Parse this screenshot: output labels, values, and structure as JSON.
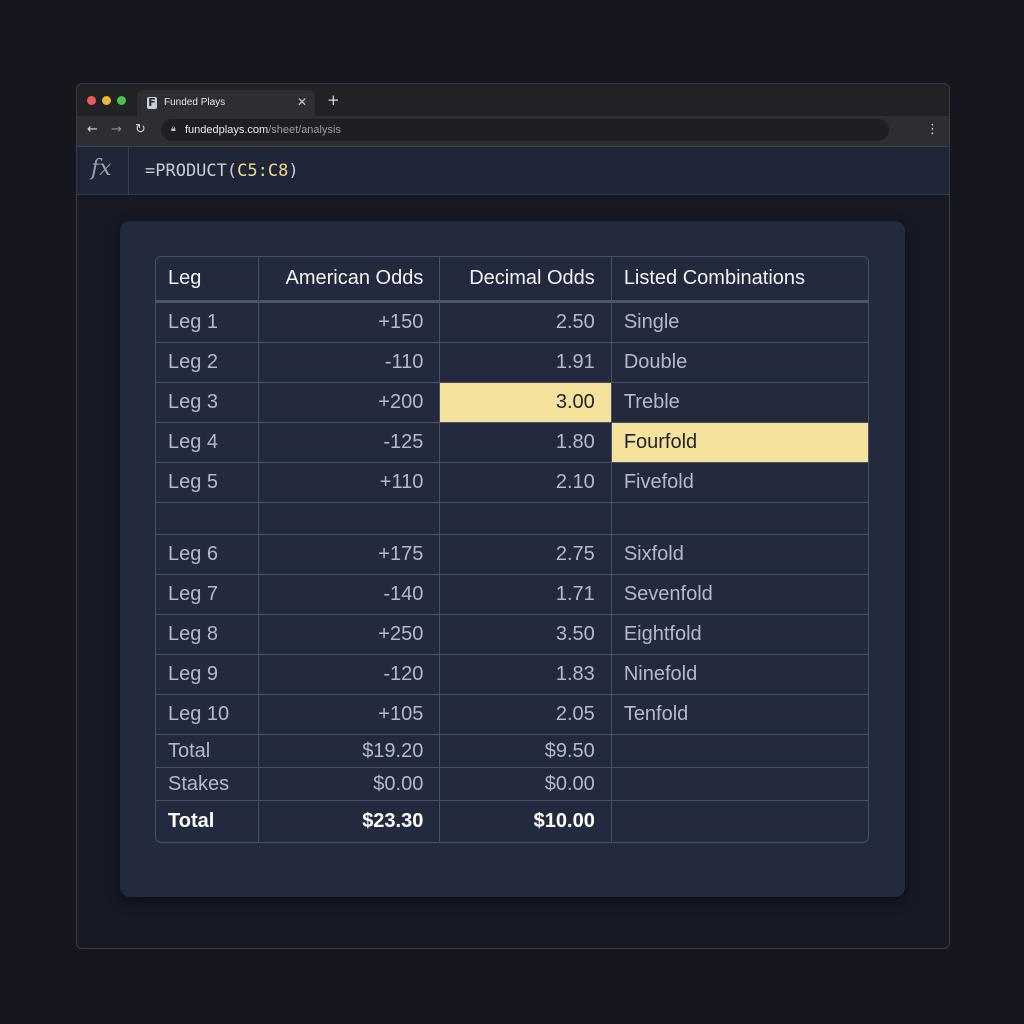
{
  "browser": {
    "tab_title": "Funded Plays",
    "tab_favicon": "F",
    "url_domain": "fundedplays.com",
    "url_path": "/sheet/analysis"
  },
  "formula_bar": {
    "fx_label": "fx",
    "prefix": "=PRODUCT(",
    "reference": "C5:C8",
    "suffix": ")"
  },
  "table": {
    "headers": [
      "Leg",
      "American Odds",
      "Decimal Odds",
      "Listed Combinations"
    ],
    "rows": [
      {
        "leg": "Leg 1",
        "american": "+150",
        "decimal": "2.50",
        "combination": "Single"
      },
      {
        "leg": "Leg 2",
        "american": "-110",
        "decimal": "1.91",
        "combination": "Double"
      },
      {
        "leg": "Leg 3",
        "american": "+200",
        "decimal": "3.00",
        "combination": "Treble"
      },
      {
        "leg": "Leg 4",
        "american": "-125",
        "decimal": "1.80",
        "combination": "Fourfold"
      },
      {
        "leg": "Leg 5",
        "american": "+110",
        "decimal": "2.10",
        "combination": "Fivefold"
      },
      {
        "leg": "Leg 6",
        "american": "+175",
        "decimal": "2.75",
        "combination": "Sixfold"
      },
      {
        "leg": "Leg 7",
        "american": "-140",
        "decimal": "1.71",
        "combination": "Sevenfold"
      },
      {
        "leg": "Leg 8",
        "american": "+250",
        "decimal": "3.50",
        "combination": "Eightfold"
      },
      {
        "leg": "Leg 9",
        "american": "-120",
        "decimal": "1.83",
        "combination": "Ninefold"
      },
      {
        "leg": "Leg 10",
        "american": "+105",
        "decimal": "2.05",
        "combination": "Tenfold"
      }
    ],
    "summary": [
      {
        "label": "Total",
        "american": "$19.20",
        "decimal": "$9.50"
      },
      {
        "label": "Stakes",
        "american": "$0.00",
        "decimal": "$0.00"
      },
      {
        "label": "Total",
        "american": "$23.30",
        "decimal": "$10.00"
      }
    ],
    "highlight_color": "#f4e29d"
  }
}
